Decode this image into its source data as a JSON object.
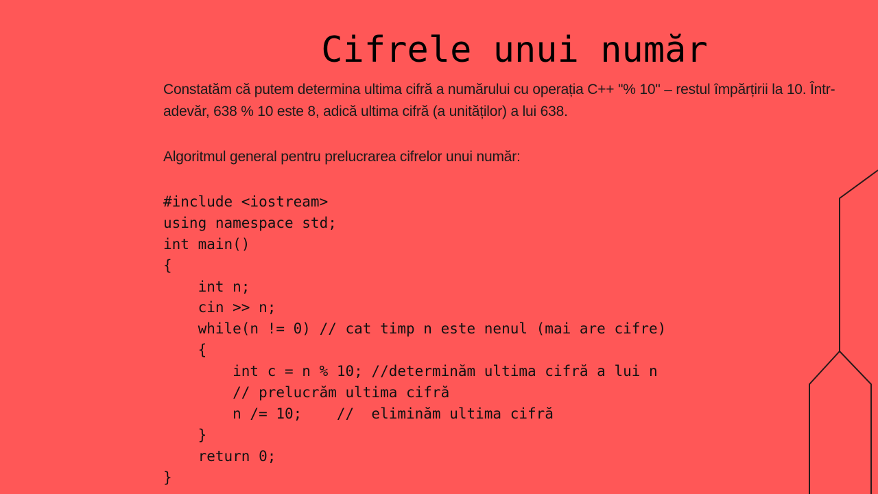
{
  "slide": {
    "title": "Cifrele unui număr",
    "paragraph_1": "Constatăm că putem determina ultima cifră a numărului cu operația C++ \"% 10\" – restul împărțirii la 10. Într-adevăr, 638 % 10 este 8, adică ultima cifră (a unităților) a lui 638.",
    "paragraph_2": "Algoritmul general pentru prelucrarea cifrelor unui număr:",
    "code_lines": [
      "#include <iostream>",
      "using namespace std;",
      "int main()",
      "{",
      "    int n;",
      "    cin >> n;",
      "    while(n != 0) // cat timp n este nenul (mai are cifre)",
      "    {",
      "        int c = n % 10; //determinăm ultima cifră a lui n",
      "        // prelucrăm ultima cifră",
      "        n /= 10;    //  eliminăm ultima cifră",
      "    }",
      "    return 0;",
      "}"
    ]
  },
  "colors": {
    "background": "#FF5757",
    "text": "#111111",
    "decoration_line": "#2a1a1a"
  }
}
